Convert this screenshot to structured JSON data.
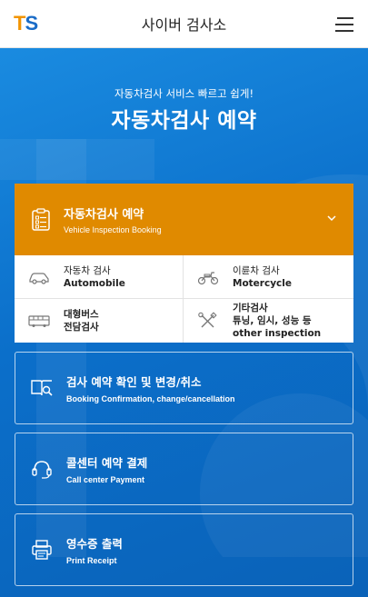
{
  "header": {
    "logo_t": "T",
    "logo_s": "S",
    "title": "사이버 검사소"
  },
  "hero": {
    "subtitle": "자동차검사 서비스 빠르고 쉽게!",
    "headline": "자동차검사 예약"
  },
  "booking": {
    "title": "자동차검사 예약",
    "title_en": "Vehicle Inspection Booking",
    "options": [
      {
        "line1": "자동차 검사",
        "line2": "Automobile"
      },
      {
        "line1": "이륜차 검사",
        "line2": "Motercycle"
      },
      {
        "line1": "대형버스",
        "line2": "전담검사"
      },
      {
        "line1": "기타검사",
        "line2": "튜닝, 임시, 성능 등",
        "line3": "other inspection"
      }
    ]
  },
  "cards": [
    {
      "title": "검사 예약 확인 및 변경/취소",
      "title_en": "Booking Confirmation, change/cancellation"
    },
    {
      "title": "콜센터 예약 결제",
      "title_en": "Call center Payment"
    },
    {
      "title": "영수증 출력",
      "title_en": "Print Receipt"
    }
  ],
  "colors": {
    "brand_orange": "#f29400",
    "brand_blue": "#1a6cc7",
    "booking_orange": "#e08a00",
    "hero_blue": "#0b6fca"
  }
}
